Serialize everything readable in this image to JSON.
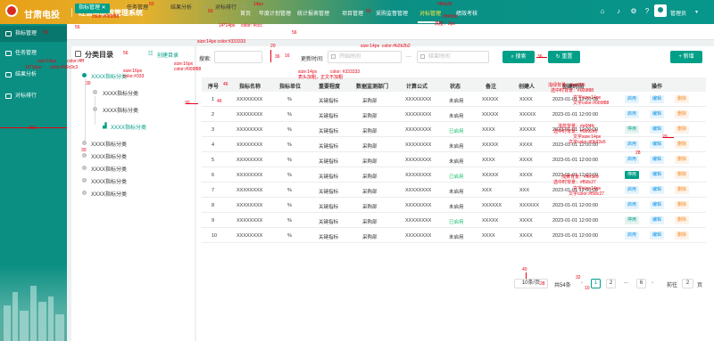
{
  "header": {
    "brand": "甘肃电投",
    "system_title": "经营与绩效管理系统",
    "nav": [
      "首页",
      "年度计划管理",
      "统计报表管理",
      "项目管理",
      "采购监督管理",
      "对标管理",
      "绩效考核"
    ],
    "active_nav": "对标管理",
    "user": "管理员",
    "icons": [
      "home-icon",
      "bell-icon",
      "settings-icon",
      "help-icon"
    ]
  },
  "sidebar": {
    "items": [
      "指标管理",
      "任务管理",
      "结果分析",
      "对标排行"
    ],
    "active": "指标管理"
  },
  "tabs": [
    {
      "label": "指标管理",
      "active": true
    },
    {
      "label": "任务管理",
      "active": false
    },
    {
      "label": "结果分析",
      "active": false
    },
    {
      "label": "对标排行",
      "active": false
    }
  ],
  "tree": {
    "title": "分类目录",
    "create_label": "创建目录",
    "nodes": [
      {
        "label": "XXXX指标分类",
        "level": 0,
        "selected": true
      },
      {
        "label": "XXXX指标分类",
        "level": 1,
        "selected": false
      },
      {
        "label": "XXXX指标分类",
        "level": 1,
        "selected": false
      },
      {
        "label": "XXXX指标分类",
        "level": 2,
        "selected": true
      },
      {
        "label": "XXXX指标分类",
        "level": 0,
        "selected": false
      },
      {
        "label": "XXXX指标分类",
        "level": 0,
        "selected": false
      },
      {
        "label": "XXXX指标分类",
        "level": 0,
        "selected": false
      },
      {
        "label": "XXXX指标分类",
        "level": 0,
        "selected": false
      },
      {
        "label": "XXXX指标分类",
        "level": 0,
        "selected": false
      }
    ]
  },
  "search": {
    "label": "搜索:",
    "time_label": "更新时间:",
    "start_placeholder": "开始时间",
    "end_placeholder": "结束时间",
    "separator": "—",
    "search_btn": "搜索",
    "reset_btn": "重置",
    "add_btn": "新增"
  },
  "table": {
    "columns": [
      "序号",
      "指标名称",
      "指标单位",
      "重要程度",
      "数据监测部门",
      "计算公式",
      "状态",
      "备注",
      "创建人",
      "创建时间",
      "操作"
    ],
    "rows": [
      {
        "no": "1",
        "name": "XXXXXXXX",
        "unit": "%",
        "level": "关键指标",
        "dept": "采购部",
        "formula": "XXXXXXXX",
        "status": "未启用",
        "note": "XXXXX",
        "creator": "XXXX",
        "time": "2023-01-01 12:00:00",
        "op1": "启用"
      },
      {
        "no": "2",
        "name": "XXXXXXXX",
        "unit": "%",
        "level": "关键指标",
        "dept": "采购部",
        "formula": "XXXXXXXX",
        "status": "未启用",
        "note": "XXXXX",
        "creator": "XXXXX",
        "time": "2023-01-01 12:00:00",
        "op1": "启用"
      },
      {
        "no": "3",
        "name": "XXXXXXXX",
        "unit": "%",
        "level": "关键指标",
        "dept": "采购部",
        "formula": "XXXXXXXX",
        "status": "已启用",
        "note": "XXXX",
        "creator": "XXXXX",
        "time": "2023-01-01 12:00:00",
        "op1": "停用"
      },
      {
        "no": "4",
        "name": "XXXXXXXX",
        "unit": "%",
        "level": "关键指标",
        "dept": "采购部",
        "formula": "XXXXXXXX",
        "status": "未启用",
        "note": "XXXXX",
        "creator": "XXXX",
        "time": "2023-01-01 12:00:00",
        "op1": "启用"
      },
      {
        "no": "5",
        "name": "XXXXXXXX",
        "unit": "%",
        "level": "关键指标",
        "dept": "采购部",
        "formula": "XXXXXXXX",
        "status": "未启用",
        "note": "XXXX",
        "creator": "XXXX",
        "time": "2023-01-01 12:00:00",
        "op1": "启用"
      },
      {
        "no": "6",
        "name": "XXXXXXXX",
        "unit": "%",
        "level": "关键指标",
        "dept": "采购部",
        "formula": "XXXXXXXX",
        "status": "已启用",
        "note": "XXXXX",
        "creator": "XXXX",
        "time": "2023-01-01 12:00:00",
        "op1": "停用"
      },
      {
        "no": "7",
        "name": "XXXXXXXX",
        "unit": "%",
        "level": "关键指标",
        "dept": "采购部",
        "formula": "XXXXXXXX",
        "status": "未启用",
        "note": "XXX",
        "creator": "XXX",
        "time": "2023-01-01 12:00:00",
        "op1": "启用"
      },
      {
        "no": "8",
        "name": "XXXXXXXX",
        "unit": "%",
        "level": "关键指标",
        "dept": "采购部",
        "formula": "XXXXXXXX",
        "status": "未启用",
        "note": "XXXXXX",
        "creator": "XXXXXX",
        "time": "2023-01-01 12:00:00",
        "op1": "启用"
      },
      {
        "no": "9",
        "name": "XXXXXXXX",
        "unit": "%",
        "level": "关键指标",
        "dept": "采购部",
        "formula": "XXXXXXXX",
        "status": "已启用",
        "note": "XXXXX",
        "creator": "XXXX",
        "time": "2023-01-01 12:00:00",
        "op1": "停用"
      },
      {
        "no": "10",
        "name": "XXXXXXXX",
        "unit": "%",
        "level": "关键指标",
        "dept": "采购部",
        "formula": "XXXXXXXX",
        "status": "未启用",
        "note": "XXXX",
        "creator": "XXXX",
        "time": "2023-01-01 12:00:00",
        "op1": "启用"
      }
    ],
    "edit_label": "编辑",
    "delete_label": "删除"
  },
  "pagination": {
    "page_size": "10条/页",
    "total": "共54条",
    "pages": [
      "1",
      "2",
      "...",
      "6"
    ],
    "goto_label": "前往",
    "goto_value": "2",
    "page_unit": "页"
  },
  "annotations": {
    "a_header_h": "60",
    "a_top1": "14px",
    "a_top2": "#ffeb3b",
    "a_top3": "color: #ffffff",
    "a_activebar": "高度：2px",
    "a_activecolor": "#fbf50d",
    "a_tab_size": "14*14px",
    "a_tab_color": "color: #ccc",
    "a_tab_font": "size:14px  color:#333333",
    "a_tab_active": "color:#009f88",
    "a_56a": "56",
    "a_56b": "56",
    "a_56c": "56",
    "a_36a": "36",
    "a_36b": "36",
    "a_20a": "20",
    "a_16a": "16",
    "a_size14": "size:14px",
    "a_border": "color:#b2b2b2",
    "a_tree_size": "size:16px",
    "a_tree_color": "color:#333",
    "a_create_size": "size:16px",
    "a_create_color": "color:#009f88",
    "a_sb_size": "size:14px",
    "a_sb_color": "color:#fff",
    "a_sb_size2": "16*16px",
    "a_sb_color2": "color:#99c9c3",
    "a_30a": "30",
    "a_30b": "30",
    "a_30c": "30",
    "a_46a": "46",
    "a_46b": "46",
    "a_th_size": "size:14px",
    "a_th_color": "color: #333333",
    "a_th_bold": "表头加粗，正文不加粗",
    "a_op1": "浅绿背景：#ebf7f6",
    "a_op2": "选中时背景：#009f88",
    "a_op3": "文字size:14px",
    "a_op4": "文字color:#009f88",
    "a_op5": "浅蓝背景：#e6f4fc",
    "a_op6": "选中时背景：#0b92e5",
    "a_op7": "文字size:14px",
    "a_op8": "文字color:#0b92e5",
    "a_op9": "浅黄背景：#fef3e9",
    "a_op10": "选中时背景：#f58c27",
    "a_op11": "文字size:14px",
    "a_op12": "文字color:#f58c27",
    "a_20b": "20",
    "a_28": "28",
    "a_32": "32",
    "a_40": "40",
    "a_10": "10",
    "a_28b": "28",
    "a_266": "266"
  },
  "colors": {
    "primary": "#009f88",
    "sidebar": "#0a8f82",
    "annotation": "#e60012",
    "blue": "#0b92e5",
    "orange": "#f58c27",
    "green_status": "#19be6b"
  }
}
